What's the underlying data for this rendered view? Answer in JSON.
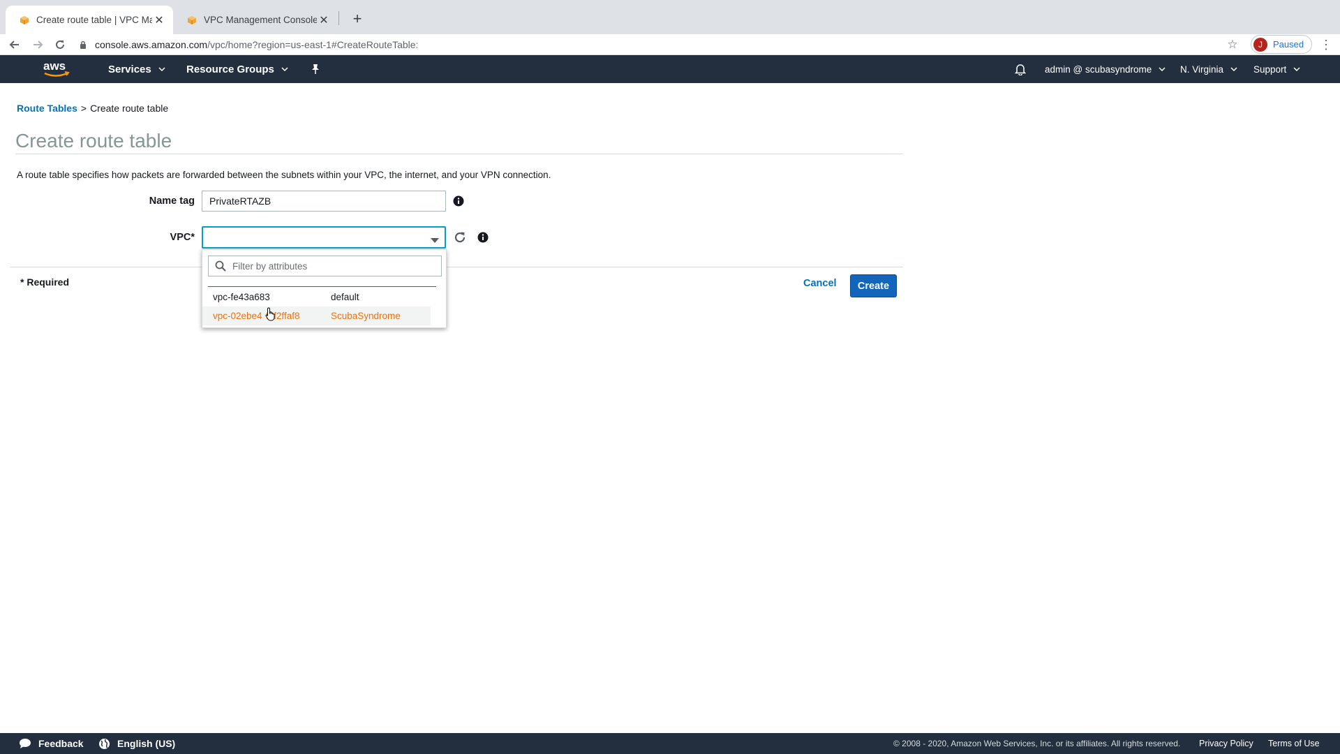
{
  "browser": {
    "tabs": [
      {
        "title": "Create route table | VPC Mana",
        "active": true
      },
      {
        "title": "VPC Management Console",
        "active": false
      }
    ],
    "url_host": "console.aws.amazon.com",
    "url_path": "/vpc/home?region=us-east-1#CreateRouteTable:",
    "profile_initial": "J",
    "profile_status": "Paused"
  },
  "awsnav": {
    "services": "Services",
    "resource_groups": "Resource Groups",
    "account": "admin @ scubasyndrome",
    "region": "N. Virginia",
    "support": "Support"
  },
  "breadcrumb": {
    "parent": "Route Tables",
    "separator": ">",
    "current": "Create route table"
  },
  "page": {
    "title": "Create route table",
    "description": "A route table specifies how packets are forwarded between the subnets within your VPC, the internet, and your VPN connection."
  },
  "form": {
    "name_tag_label": "Name tag",
    "name_tag_value": "PrivateRTAZB",
    "vpc_label": "VPC*",
    "vpc_value": "",
    "filter_placeholder": "Filter by attributes",
    "vpc_options": [
      {
        "id": "vpc-fe43a683",
        "name": "default"
      },
      {
        "id": "vpc-02ebe4  f7f2ffaf8",
        "name": "ScubaSyndrome"
      }
    ],
    "required_note": "* Required",
    "cancel_label": "Cancel",
    "create_label": "Create"
  },
  "footer": {
    "feedback": "Feedback",
    "language": "English (US)",
    "copyright": "© 2008 - 2020, Amazon Web Services, Inc. or its affiliates. All rights reserved.",
    "privacy": "Privacy Policy",
    "terms": "Terms of Use"
  },
  "colors": {
    "aws_nav": "#232f3e",
    "link": "#0073bb",
    "primary_button": "#1166bb",
    "highlight_option": "#ec7211",
    "focus_border": "#00a1c9"
  }
}
